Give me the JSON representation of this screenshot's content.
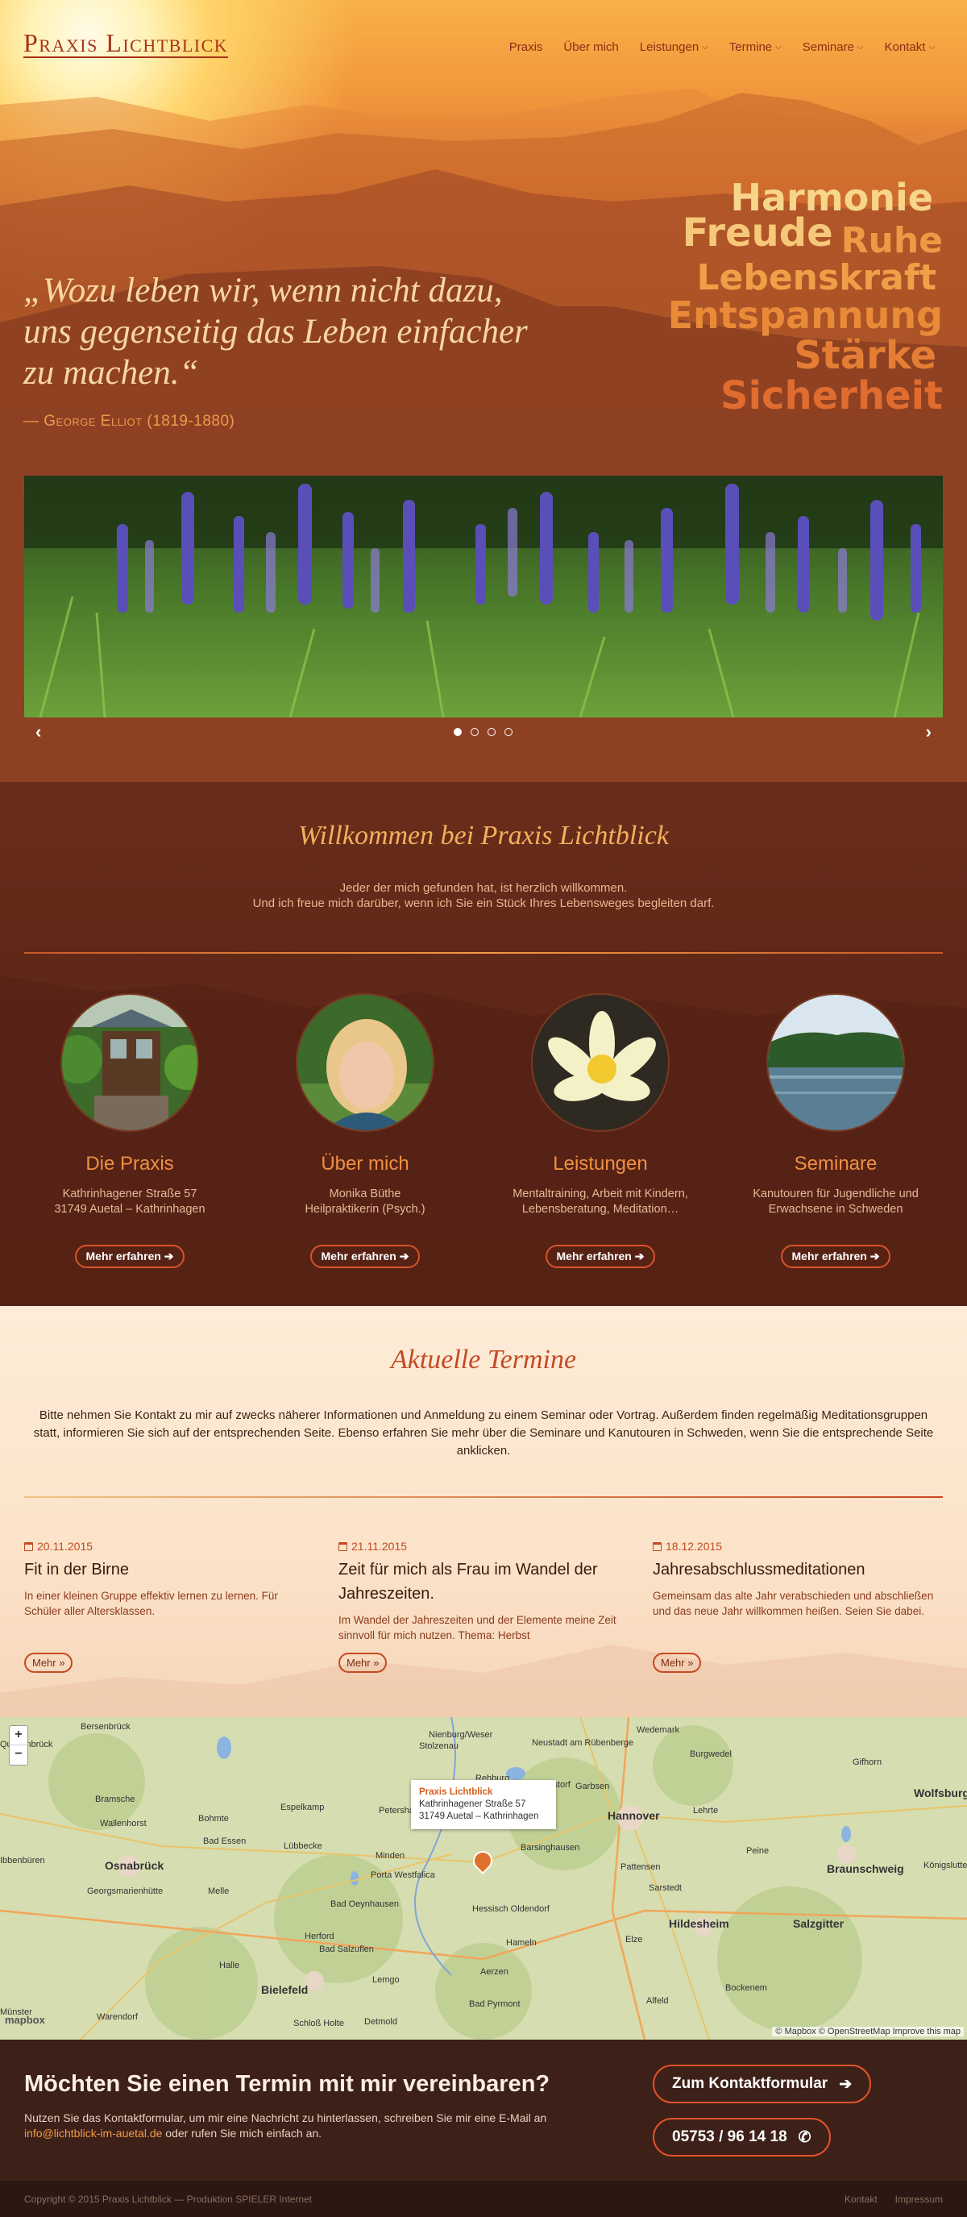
{
  "header": {
    "logo": "Praxis Lichtblick",
    "nav": [
      {
        "label": "Praxis",
        "dropdown": false
      },
      {
        "label": "Über mich",
        "dropdown": false
      },
      {
        "label": "Leistungen",
        "dropdown": true
      },
      {
        "label": "Termine",
        "dropdown": true
      },
      {
        "label": "Seminare",
        "dropdown": true
      },
      {
        "label": "Kontakt",
        "dropdown": true
      }
    ]
  },
  "hero": {
    "quote": "„Wozu leben wir, wenn nicht dazu, uns gegenseitig das Leben einfacher zu machen.“",
    "author": "— George Elliot (1819-1880)",
    "words": [
      "Harmonie",
      "Freude",
      "Ruhe",
      "Lebenskraft",
      "Entspannung",
      "Stärke",
      "Sicherheit"
    ]
  },
  "slider": {
    "prev": "‹",
    "next": "›",
    "slides": 4,
    "active": 0
  },
  "welcome": {
    "title": "Willkommen bei Praxis Lichtblick",
    "line1": "Jeder der mich gefunden hat, ist herzlich willkommen.",
    "line2": "Und ich freue mich darüber, wenn ich Sie ein Stück Ihres Lebensweges begleiten darf.",
    "cards": [
      {
        "title": "Die Praxis",
        "line1": "Kathrinhagener Straße 57",
        "line2": "31749 Auetal – Kathrinhagen",
        "button": "Mehr erfahren"
      },
      {
        "title": "Über mich",
        "line1": "Monika Büthe",
        "line2": "Heilpraktikerin (Psych.)",
        "button": "Mehr erfahren"
      },
      {
        "title": "Leistungen",
        "line1": "Mentaltraining, Arbeit mit Kindern,",
        "line2": "Lebensberatung, Meditation…",
        "button": "Mehr erfahren"
      },
      {
        "title": "Seminare",
        "line1": "Kanutouren für Jugendliche und",
        "line2": "Erwachsene in Schweden",
        "button": "Mehr erfahren"
      }
    ]
  },
  "termine": {
    "title": "Aktuelle Termine",
    "intro": "Bitte nehmen Sie Kontakt zu mir auf zwecks näherer Informationen und Anmeldung zu einem Seminar oder Vortrag. Außerdem finden regelmäßig Meditationsgruppen statt, informieren Sie sich auf der entsprechenden Seite. Ebenso erfahren Sie mehr über die Seminare und Kanutouren in Schweden, wenn Sie die entsprechende Seite anklicken.",
    "events": [
      {
        "date": "20.11.2015",
        "title": "Fit in der Birne",
        "text": "In einer kleinen Gruppe effektiv lernen zu lernen. Für Schüler aller Altersklassen.",
        "button": "Mehr »"
      },
      {
        "date": "21.11.2015",
        "title": "Zeit für mich als Frau im Wandel der Jahreszeiten.",
        "text": "Im Wandel der Jahreszeiten und der Elemente meine Zeit sinnvoll für mich nutzen. Thema: Herbst",
        "button": "Mehr »"
      },
      {
        "date": "18.12.2015",
        "title": "Jahresabschlussmeditationen",
        "text": "Gemeinsam das alte Jahr verabschieden und abschließen und das neue Jahr willkommen heißen. Seien Sie dabei.",
        "button": "Mehr »"
      }
    ]
  },
  "map": {
    "zoom_in": "+",
    "zoom_out": "−",
    "popup": {
      "name": "Praxis Lichtblick",
      "street": "Kathrinhagener Straße 57",
      "city": "31749 Auetal – Kathrinhagen"
    },
    "credit": "© Mapbox © OpenStreetMap Improve this map",
    "logo": "mapbox",
    "labels": [
      "Bersenbrück",
      "Quakenbrück",
      "Bramsche",
      "Wallenhorst",
      "Osnabrück",
      "Georgsmarienhütte",
      "Ibbenbüren",
      "Bohmte",
      "Bad Essen",
      "Espelkamp",
      "Lübbecke",
      "Melle",
      "Petershagen",
      "Minden",
      "Porta Westfalica",
      "Bad Oeynhausen",
      "Herford",
      "Bad Salzuflen",
      "Bielefeld",
      "Lemgo",
      "Detmold",
      "Halle",
      "Warendorf",
      "Schloß Holte",
      "Münster",
      "Nienburg/Weser",
      "Stolzenau",
      "Rehburg",
      "Neustadt am Rübenberge",
      "Wunstorf",
      "Garbsen",
      "Barsinghausen",
      "Hannover",
      "Hessisch Oldendorf",
      "Hameln",
      "Aerzen",
      "Bad Pyrmont",
      "Wedemark",
      "Burgwedel",
      "Lehrte",
      "Sarstedt",
      "Pattensen",
      "Hildesheim",
      "Elze",
      "Alfeld",
      "Bockenem",
      "Salzgitter",
      "Braunschweig",
      "Peine",
      "Gifhorn",
      "Wolfsburg",
      "Königslutter am Elm"
    ]
  },
  "cta": {
    "title": "Möchten Sie einen Termin mit mir vereinbaren?",
    "text_before": "Nutzen Sie das Kontaktformular, um mir eine Nachricht zu hinterlassen, schreiben Sie mir eine E-Mail an",
    "email": "info@lichtblick-im-auetal.de",
    "text_after": "oder rufen Sie mich einfach an.",
    "button_form": "Zum Kontaktformular",
    "button_phone": "05753 / 96 14 18"
  },
  "footer": {
    "copyright": "Copyright © 2015 Praxis Lichtblick — Produktion SPIELER Internet",
    "links": [
      "Kontakt",
      "Impressum"
    ]
  },
  "colors": {
    "accent": "#e0532a",
    "brand": "#a8321a",
    "gold": "#f2b05c"
  }
}
